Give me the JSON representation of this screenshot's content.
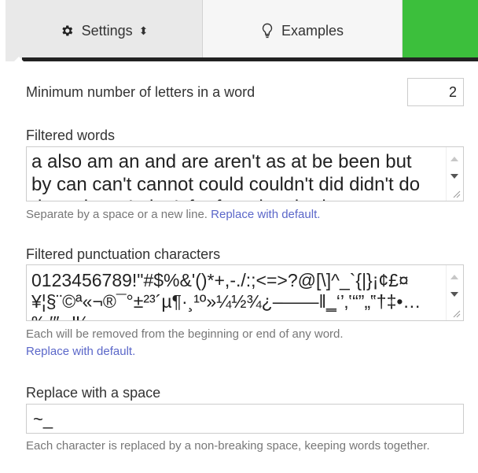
{
  "tabs": {
    "settings": {
      "label": "Settings",
      "icon": "gear-icon"
    },
    "examples": {
      "label": "Examples",
      "icon": "lightbulb-icon"
    },
    "accent_color": "#3cbf3c"
  },
  "min_letters": {
    "label": "Minimum number of letters in a word",
    "value": "2"
  },
  "filtered_words": {
    "label": "Filtered words",
    "value": "a also am an and are aren't as at be been but by can can't cannot could couldn't did didn't do does doesn't don't for from has had",
    "help_text": "Separate by a space or a new line.",
    "help_link": "Replace with default."
  },
  "filtered_punctuation": {
    "label": "Filtered punctuation characters",
    "value": "0123456789!\"#$%&'()*+,-./:;<=>?@[\\]^_`{|}¡¢£¤¥¦§¨©ª«¬®¯°±²³´µ¶·¸¹º»¼½¾¿–—―‖‗‘’‚‛“”„‟†‡•…‰′″‹›‼⁄",
    "help_text": "Each will be removed from the beginning or end of any word.",
    "help_link": "Replace with default."
  },
  "replace_space": {
    "label": "Replace with a space",
    "value": "~_",
    "help_text": "Each character is replaced by a non-breaking space, keeping words together."
  }
}
